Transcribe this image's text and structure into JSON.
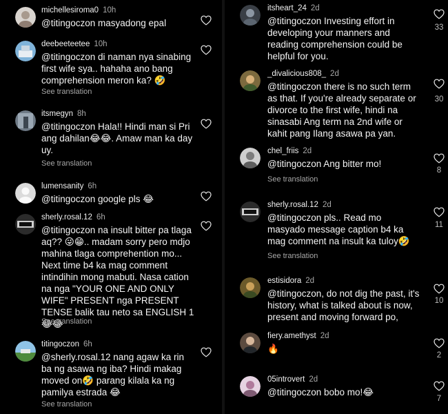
{
  "comments_left": [
    {
      "user": "michellesiroma0",
      "time": "10h",
      "text": "@titingoczon masyadong epal",
      "see": "",
      "likes": ""
    },
    {
      "user": "deebeeteetee",
      "time": "10h",
      "text": "@titingoczon di naman nya sinabing first wife sya.. hahaha ano bang comprehension meron ka? 🤣",
      "see": "See translation",
      "likes": ""
    },
    {
      "user": "itsmegyn",
      "time": "8h",
      "text": "@titingoczon Hala!! Hindi man si Pri ang dahilan😂😂. Amaw man ka day uy.",
      "see": "See translation",
      "likes": ""
    },
    {
      "user": "lumensanity",
      "time": "6h",
      "text": "@titingoczon google pls 😂",
      "see": "",
      "likes": ""
    },
    {
      "user": "sherly.rosal.12",
      "time": "6h",
      "text": "@titingoczon na insult bitter pa tlaga aq?? 😜😁.. madam sorry pero mdjo mahina tlaga comprehention mo... Next time b4 ka mag comment intindihin mong mabuti. Nasa cation na nga \"YOUR ONE AND ONLY WIFE\" PRESENT nga PRESENT TENSE balik tau neto sa ENGLISH 1 😂😂",
      "see": "See translation",
      "likes": ""
    },
    {
      "user": "titingoczon",
      "time": "6h",
      "text": "@sherly.rosal.12  nang agaw ka rin ba ng asawa ng iba? Hindi makag moved on🤣 parang kilala ka ng pamilya estrada 😂",
      "see": "See translation",
      "likes": ""
    }
  ],
  "comments_right": [
    {
      "user": "itsheart_24",
      "time": "2d",
      "text": "@titingoczon Investing effort in developing your manners and reading comprehension could be helpful for you.",
      "see": "",
      "likes": "33"
    },
    {
      "user": "_divalicious808_",
      "time": "2d",
      "text": "@titingoczon there is no such term as that.  If you're already separate or divorce to the first wife, hindi na sinasabi Ang term na 2nd wife or kahit pang Ilang asawa pa yan.",
      "see": "",
      "likes": "30"
    },
    {
      "user": "chel_friis",
      "time": "2d",
      "text": "@titingoczon Ang bitter mo!",
      "see": "See translation",
      "likes": "8"
    },
    {
      "user": "sherly.rosal.12",
      "time": "2d",
      "text": "@titingoczon pls.. Read mo masyado message caption b4 ka mag comment na insult ka tuloy🤣",
      "see": "See translation",
      "likes": "11"
    },
    {
      "user": "estisidora",
      "time": "2d",
      "text": "@titingoczon, do not dig the past, it's history, what is talked about is now, present and moving forward po,",
      "see": "",
      "likes": "10"
    },
    {
      "user": "fiery.amethyst",
      "time": "2d",
      "text": "🔥",
      "see": "",
      "likes": "2"
    },
    {
      "user": "05introvert",
      "time": "2d",
      "text": "@titingoczon bobo mo!😂",
      "see": "",
      "likes": "7"
    }
  ],
  "icons": {
    "like": "heart-outline-icon",
    "avatar": "user-avatar"
  },
  "colors": {
    "background": "#000000",
    "text": "#f5f5f5",
    "muted": "#a8a8a8"
  }
}
